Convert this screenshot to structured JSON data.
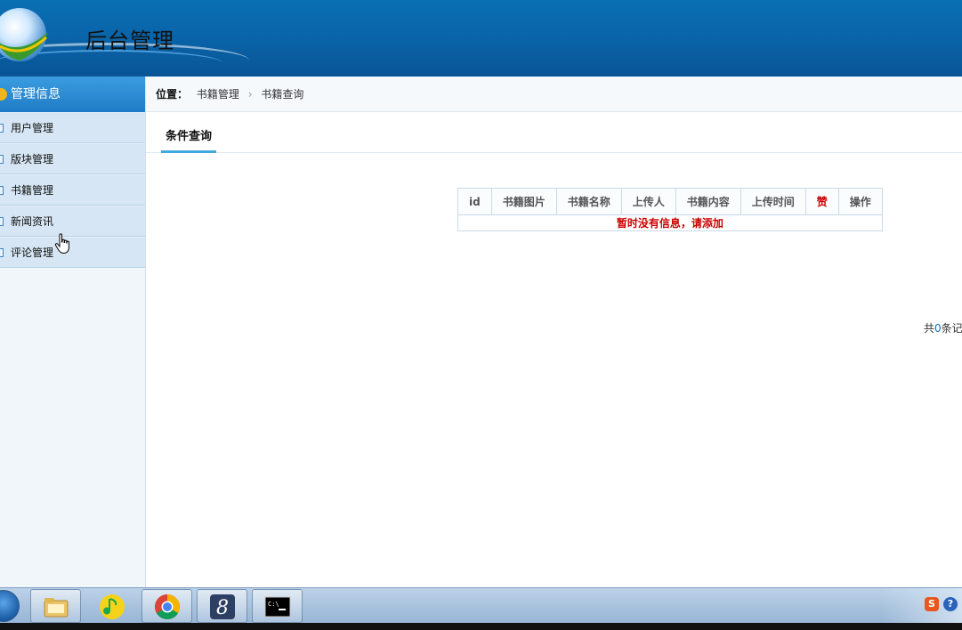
{
  "header": {
    "title": "后台管理"
  },
  "sidebar": {
    "heading": "管理信息",
    "items": [
      {
        "label": "用户管理"
      },
      {
        "label": "版块管理"
      },
      {
        "label": "书籍管理"
      },
      {
        "label": "新闻资讯"
      },
      {
        "label": "评论管理"
      }
    ]
  },
  "breadcrumb": {
    "label": "位置：",
    "parent": "书籍管理",
    "current": "书籍查询"
  },
  "tab": {
    "label": "条件查询"
  },
  "table": {
    "columns": [
      "id",
      "书籍图片",
      "书籍名称",
      "上传人",
      "书籍内容",
      "上传时间",
      "赞",
      "操作"
    ],
    "empty_message": "暂时没有信息，请添加"
  },
  "pagination": {
    "prefix": "共",
    "count": "0",
    "suffix": "条记"
  },
  "taskbar": {
    "apps": [
      "file-explorer-icon",
      "qq-music-icon",
      "chrome-icon",
      "eclipse-icon",
      "command-prompt-icon"
    ],
    "tray": {
      "ime": "S",
      "help": "?"
    }
  },
  "colors": {
    "header": "#0a6fb4",
    "sidebar_head": "#1f7cc6",
    "accent": "#3ea8e0",
    "empty_text": "#cc0000"
  }
}
